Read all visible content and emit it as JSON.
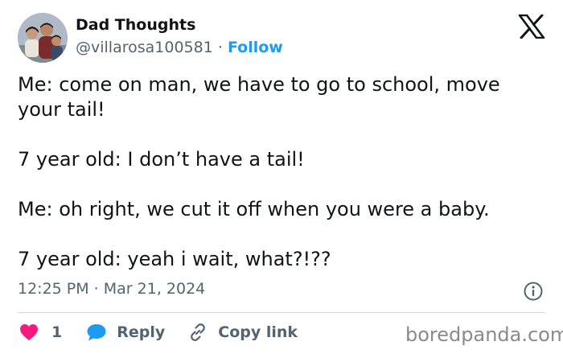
{
  "author": {
    "display_name": "Dad Thoughts",
    "handle": "@villarosa100581",
    "separator": "·",
    "follow_label": "Follow",
    "avatar_icon": "family-photo-avatar"
  },
  "brand_icon": "x-logo-icon",
  "tweet": {
    "lines": [
      "Me: come on man, we have to go to school, move your tail!",
      "7 year old: I don’t have a tail!",
      "Me: oh right, we cut it off when you were a baby.",
      "7 year old: yeah i wait, what?!??"
    ],
    "timestamp": "12:25 PM · Mar 21, 2024"
  },
  "actions": {
    "like_count": "1",
    "reply_label": "Reply",
    "copy_link_label": "Copy link"
  },
  "watermark": "boredpanda.com",
  "colors": {
    "accent": "#1d9bf0",
    "like": "#f91880",
    "text": "#0f1419",
    "muted": "#536471",
    "divider": "#cfd9de"
  }
}
